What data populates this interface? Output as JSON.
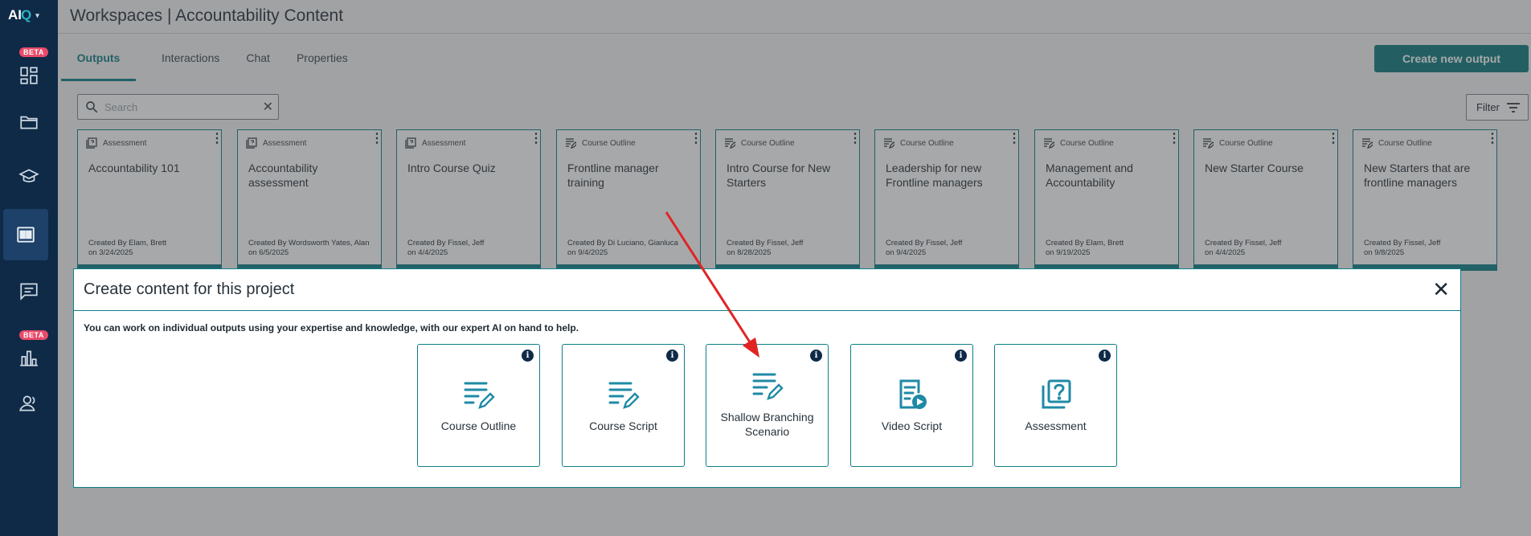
{
  "app": {
    "logo": "AI",
    "logo_caret": "▾"
  },
  "sidebar": {
    "items": [
      {
        "name": "dashboard",
        "beta": "BETA"
      },
      {
        "name": "folders"
      },
      {
        "name": "courses"
      },
      {
        "name": "workspaces",
        "active": true
      },
      {
        "name": "chat"
      },
      {
        "name": "analytics",
        "beta": "BETA"
      },
      {
        "name": "users"
      }
    ]
  },
  "header": {
    "title": "Workspaces |  Accountability Content"
  },
  "tabs": [
    {
      "label": "Outputs",
      "active": true
    },
    {
      "label": "Interactions"
    },
    {
      "label": "Chat"
    },
    {
      "label": "Properties"
    }
  ],
  "toolbar": {
    "create_label": "Create new output",
    "filter_label": "Filter"
  },
  "search": {
    "placeholder": "Search",
    "clear": "✕"
  },
  "cards": [
    {
      "type": "Assessment",
      "title": "Accountability 101",
      "meta1": "Created By Elam, Brett",
      "meta2": "on 3/24/2025"
    },
    {
      "type": "Assessment",
      "title": "Accountability assessment",
      "meta1": "Created By Wordsworth Yates, Alan",
      "meta2": "on 6/5/2025"
    },
    {
      "type": "Assessment",
      "title": "Intro Course Quiz",
      "meta1": "Created By Fissel, Jeff",
      "meta2": "on 4/4/2025"
    },
    {
      "type": "Course Outline",
      "title": "Frontline manager training",
      "meta1": "Created By Di Luciano, Gianluca",
      "meta2": "on 9/4/2025"
    },
    {
      "type": "Course Outline",
      "title": "Intro Course for New Starters",
      "meta1": "Created By Fissel, Jeff",
      "meta2": "on 8/28/2025"
    },
    {
      "type": "Course Outline",
      "title": "Leadership for new Frontline managers",
      "meta1": "Created By Fissel, Jeff",
      "meta2": "on 9/4/2025"
    },
    {
      "type": "Course Outline",
      "title": "Management and Accountability",
      "meta1": "Created By Elam, Brett",
      "meta2": "on 9/19/2025"
    },
    {
      "type": "Course Outline",
      "title": "New Starter Course",
      "meta1": "Created By Fissel, Jeff",
      "meta2": "on 4/4/2025"
    },
    {
      "type": "Course Outline",
      "title": "New Starters that are frontline managers",
      "meta1": "Created By Fissel, Jeff",
      "meta2": "on 9/8/2025"
    }
  ],
  "modal": {
    "title": "Create content for this project",
    "close": "✕",
    "description": "You can work on individual outputs using your expertise and knowledge, with our expert AI on hand to help.",
    "options": [
      {
        "label": "Course Outline",
        "icon": "list-pencil-icon"
      },
      {
        "label": "Course Script",
        "icon": "list-pencil-icon"
      },
      {
        "label": "Shallow Branching Scenario",
        "icon": "list-pencil-icon"
      },
      {
        "label": "Video Script",
        "icon": "document-play-icon"
      },
      {
        "label": "Assessment",
        "icon": "question-pages-icon"
      }
    ],
    "info_glyph": "i"
  },
  "colors": {
    "accent": "#0e7f87",
    "sidebar": "#0e2a47",
    "beta": "#e84b6a",
    "annotation_arrow": "#e02424"
  }
}
